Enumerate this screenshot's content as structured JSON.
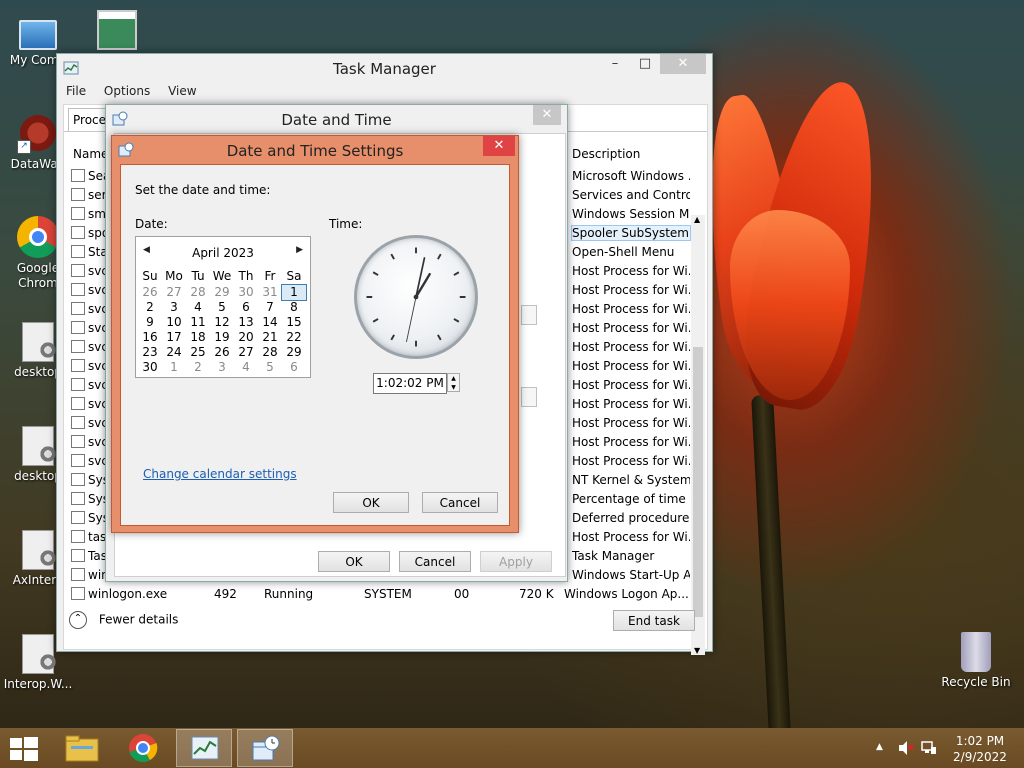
{
  "desktop": {
    "icons": [
      {
        "name": "my-computer",
        "label": "My Comp"
      },
      {
        "name": "security-center",
        "label": ""
      },
      {
        "name": "datawag",
        "label": "DataWag"
      },
      {
        "name": "google-chrome",
        "label": "Google Chrom"
      },
      {
        "name": "desktop-1",
        "label": "desktop"
      },
      {
        "name": "desktop-2",
        "label": "desktop"
      },
      {
        "name": "axinterop",
        "label": "AxIntero"
      },
      {
        "name": "interop",
        "label": "Interop.W..."
      },
      {
        "name": "recycle-bin",
        "label": "Recycle Bin"
      }
    ]
  },
  "task_manager": {
    "title": "Task Manager",
    "menu": [
      "File",
      "Options",
      "View"
    ],
    "tab": "Proces",
    "col_name": "Name",
    "col_description": "Description",
    "rows": [
      {
        "name": "Sear",
        "desc": "Microsoft Windows ..."
      },
      {
        "name": "serv",
        "desc": "Services and Control..."
      },
      {
        "name": "sms",
        "desc": "Windows Session M..."
      },
      {
        "name": "spoo",
        "desc": "Spooler SubSystem ..."
      },
      {
        "name": "Star",
        "desc": "Open-Shell Menu"
      },
      {
        "name": "svch",
        "desc": "Host Process for Wi..."
      },
      {
        "name": "svch",
        "desc": "Host Process for Wi..."
      },
      {
        "name": "svch",
        "desc": "Host Process for Wi..."
      },
      {
        "name": "svch",
        "desc": "Host Process for Wi..."
      },
      {
        "name": "svch",
        "desc": "Host Process for Wi..."
      },
      {
        "name": "svch",
        "desc": "Host Process for Wi..."
      },
      {
        "name": "svch",
        "desc": "Host Process for Wi..."
      },
      {
        "name": "svch",
        "desc": "Host Process for Wi..."
      },
      {
        "name": "svch",
        "desc": "Host Process for Wi..."
      },
      {
        "name": "svch",
        "desc": "Host Process for Wi..."
      },
      {
        "name": "svch",
        "desc": "Host Process for Wi..."
      },
      {
        "name": "Syst",
        "desc": "NT Kernel & System"
      },
      {
        "name": "Syst",
        "desc": "Percentage of time t..."
      },
      {
        "name": "Syst",
        "desc": "Deferred procedure ..."
      },
      {
        "name": "task",
        "desc": "Host Process for Wi..."
      },
      {
        "name": "Task",
        "desc": "Task Manager"
      },
      {
        "name": "wini",
        "desc": "Windows Start-Up A..."
      }
    ],
    "last_row": {
      "name": "winlogon.exe",
      "pid": "492",
      "status": "Running",
      "user": "SYSTEM",
      "cpu": "00",
      "mem": "720 K",
      "desc": "Windows Logon Ap..."
    },
    "fewer_details": "Fewer details",
    "end_task": "End task"
  },
  "date_time": {
    "title": "Date and Time",
    "ok": "OK",
    "cancel": "Cancel",
    "apply": "Apply"
  },
  "dts": {
    "title": "Date and Time Settings",
    "instruction": "Set the date and time:",
    "date_label": "Date:",
    "time_label": "Time:",
    "month": "April 2023",
    "dow": [
      "Su",
      "Mo",
      "Tu",
      "We",
      "Th",
      "Fr",
      "Sa"
    ],
    "days": [
      [
        "26",
        "27",
        "28",
        "29",
        "30",
        "31",
        "1"
      ],
      [
        "2",
        "3",
        "4",
        "5",
        "6",
        "7",
        "8"
      ],
      [
        "9",
        "10",
        "11",
        "12",
        "13",
        "14",
        "15"
      ],
      [
        "16",
        "17",
        "18",
        "19",
        "20",
        "21",
        "22"
      ],
      [
        "23",
        "24",
        "25",
        "26",
        "27",
        "28",
        "29"
      ],
      [
        "30",
        "1",
        "2",
        "3",
        "4",
        "5",
        "6"
      ]
    ],
    "selected_day": "1",
    "time_value": "1:02:02 PM",
    "clock": {
      "hour": 13,
      "minute": 2,
      "second": 2
    },
    "change_calendar": "Change calendar settings",
    "ok": "OK",
    "cancel": "Cancel"
  },
  "taskbar": {
    "time": "1:02 PM",
    "date": "2/9/2022"
  }
}
